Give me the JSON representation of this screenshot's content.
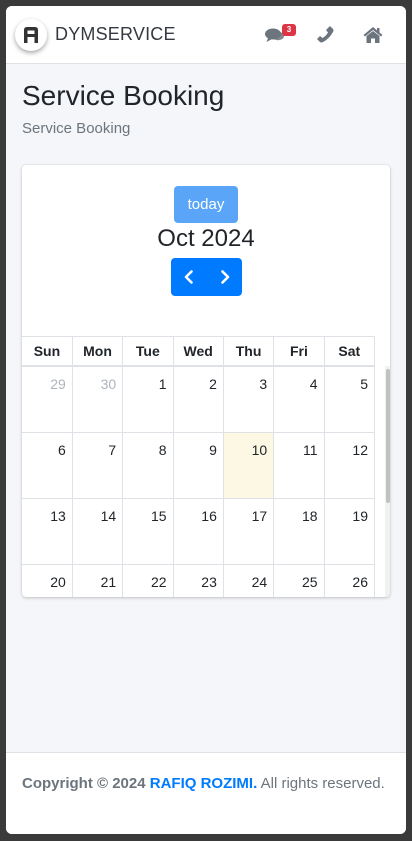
{
  "navbar": {
    "brand": "DYMSERVICE",
    "icons": [
      "logo-icon",
      "comments-icon",
      "phone-icon",
      "home-icon"
    ],
    "notification_count": "3"
  },
  "header": {
    "title": "Service Booking",
    "breadcrumb": "Service Booking"
  },
  "calendar": {
    "today_label": "today",
    "month_title": "Oct 2024",
    "weekdays": [
      "Sun",
      "Mon",
      "Tue",
      "Wed",
      "Thu",
      "Fri",
      "Sat"
    ],
    "weeks": [
      [
        "29",
        "30",
        "1",
        "2",
        "3",
        "4",
        "5"
      ],
      [
        "6",
        "7",
        "8",
        "9",
        "10",
        "11",
        "12"
      ],
      [
        "13",
        "14",
        "15",
        "16",
        "17",
        "18",
        "19"
      ],
      [
        "20",
        "21",
        "22",
        "23",
        "24",
        "25",
        "26"
      ]
    ],
    "today_date": "10"
  },
  "footer": {
    "copyright": "Copyright © 2024",
    "author": "RAFIQ ROZIMI.",
    "rights": "All rights reserved."
  },
  "colors": {
    "primary": "#007bff",
    "today_button": "#5aa5f7",
    "today_highlight": "#fcf8e3",
    "badge": "#dc3545",
    "background": "#f4f6f9"
  }
}
